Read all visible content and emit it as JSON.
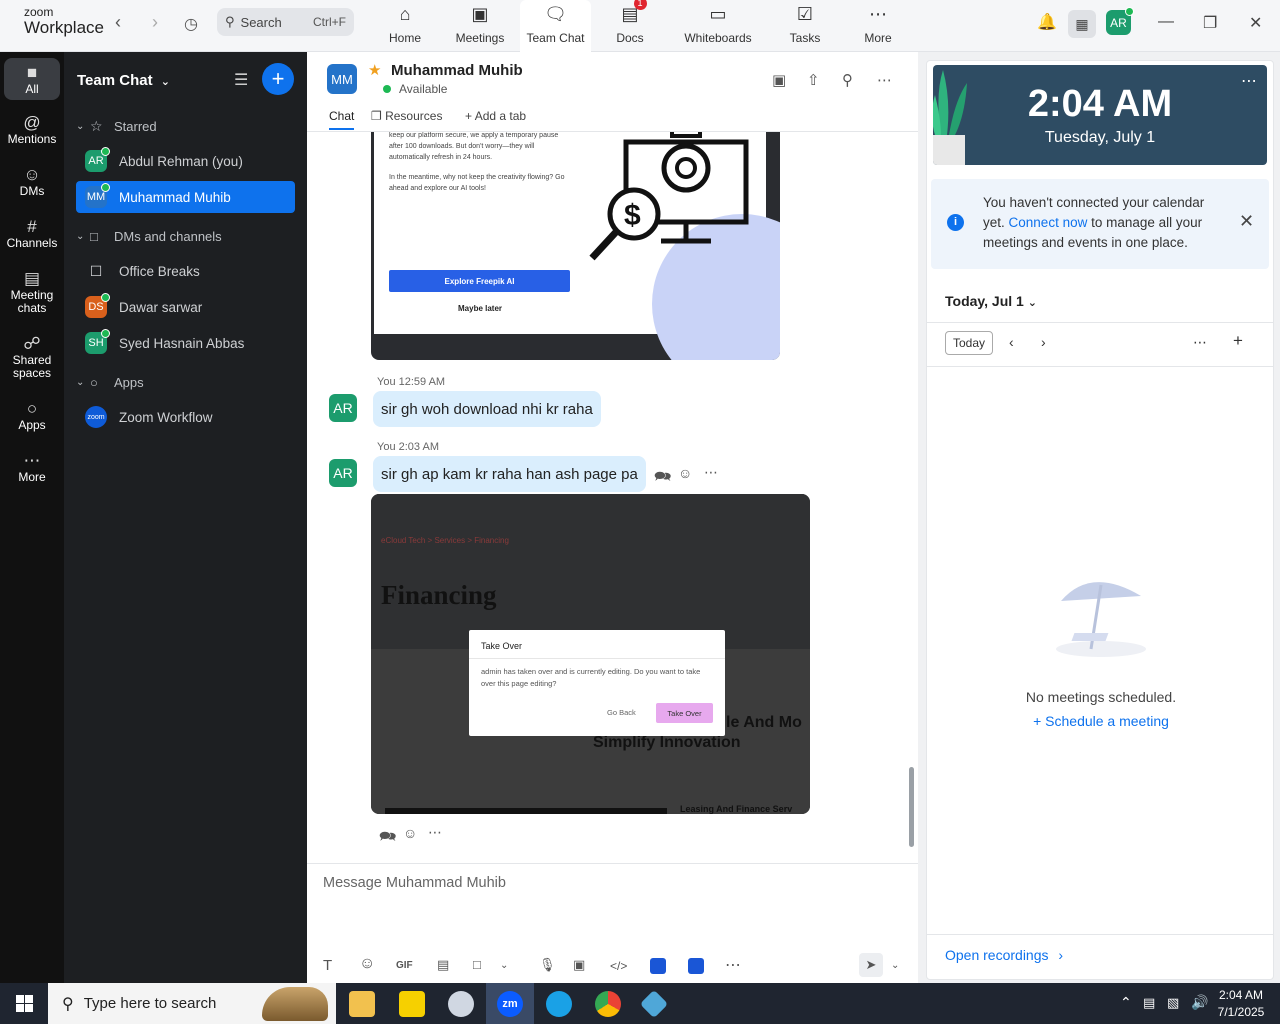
{
  "app": {
    "logo_top": "zoom",
    "logo_bottom": "Workplace"
  },
  "search": {
    "label": "Search",
    "shortcut": "Ctrl+F"
  },
  "tabs": [
    {
      "label": "Home",
      "icon": "home-icon"
    },
    {
      "label": "Meetings",
      "icon": "video-icon"
    },
    {
      "label": "Team Chat",
      "icon": "chat-icon"
    },
    {
      "label": "Docs",
      "icon": "docs-icon",
      "badge": "1"
    },
    {
      "label": "Whiteboards",
      "icon": "whiteboard-icon"
    },
    {
      "label": "Tasks",
      "icon": "tasks-icon"
    },
    {
      "label": "More",
      "icon": "more-icon"
    }
  ],
  "user_avatar": "AR",
  "rail": [
    {
      "label": "All"
    },
    {
      "label": "Mentions"
    },
    {
      "label": "DMs"
    },
    {
      "label": "Channels"
    },
    {
      "label": "Meeting chats"
    },
    {
      "label": "Shared spaces"
    },
    {
      "label": "Apps"
    },
    {
      "label": "More"
    }
  ],
  "sidebar": {
    "title": "Team Chat",
    "starred_label": "Starred",
    "dms_label": "DMs and channels",
    "apps_label": "Apps",
    "starred": [
      {
        "initials": "AR",
        "name": "Abdul Rehman (you)",
        "color": "#1c9c6d"
      },
      {
        "initials": "MM",
        "name": "Muhammad Muhib",
        "color": "#2473c9"
      }
    ],
    "channels": [
      {
        "initials": "",
        "name": "Office Breaks",
        "color": ""
      },
      {
        "initials": "DS",
        "name": "Dawar sarwar",
        "color": "#d9601c"
      },
      {
        "initials": "SH",
        "name": "Syed Hasnain Abbas",
        "color": "#1c9c6d"
      }
    ],
    "apps": [
      {
        "initials": "zoom",
        "name": "Zoom Workflow",
        "color": "#0e5bd8"
      }
    ]
  },
  "chat": {
    "initials": "MM",
    "name": "Muhammad Muhib",
    "status": "Available",
    "tabs": {
      "chat": "Chat",
      "resources": "Resources",
      "add_tab": "Add a tab"
    },
    "img1": {
      "line1": "keep our platform secure, we apply a temporary pause after 100 downloads. But don't worry—they will automatically refresh in 24 hours.",
      "line2": "In the meantime, why not keep the creativity flowing? Go ahead and explore our AI tools!",
      "button": "Explore Freepik AI",
      "later": "Maybe later"
    },
    "messages": [
      {
        "stamp": "You 12:59 AM",
        "initials": "AR",
        "text": "sir gh woh download nhi kr raha"
      },
      {
        "stamp": "You 2:03 AM",
        "initials": "AR",
        "text": "sir gh ap kam kr raha han ash page pa"
      }
    ],
    "img2": {
      "breadcrumb": "eCloud Tech  >  Services  >  Financing",
      "heading": "Financing",
      "dialog_title": "Take Over",
      "dialog_body": "admin has taken over and is currently editing. Do you want to take over this page editing?",
      "go_back": "Go Back",
      "take_over": "Take Over",
      "bg1": "le And Mo",
      "bg2": "Simplify Innovation",
      "bg3": "Leasing And Finance Serv"
    },
    "composer_placeholder": "Message Muhammad Muhib"
  },
  "right": {
    "time": "2:04 AM",
    "date": "Tuesday, July 1",
    "notice_pre": "You haven't connected your calendar yet.",
    "notice_link": "Connect now",
    "notice_post": "to manage all your meetings and events in one place.",
    "today_heading": "Today, Jul 1",
    "today_button": "Today",
    "no_meetings": "No meetings scheduled.",
    "schedule": "Schedule a meeting",
    "open_recordings": "Open recordings"
  },
  "taskbar": {
    "search": "Type here to search",
    "time": "2:04 AM",
    "date": "7/1/2025"
  }
}
